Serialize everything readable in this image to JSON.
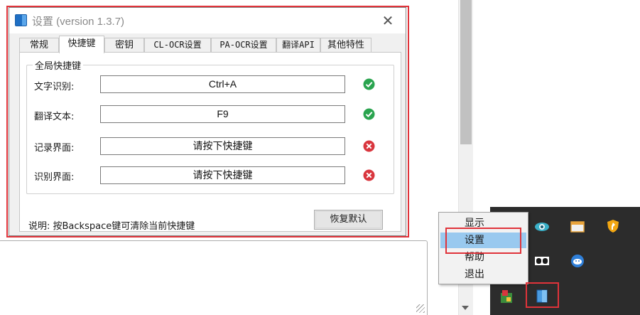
{
  "window": {
    "title": "设置  (version 1.3.7)",
    "close_glyph": "✕"
  },
  "tabs": [
    {
      "label": "常规",
      "active": false
    },
    {
      "label": "快捷键",
      "active": true
    },
    {
      "label": "密钥",
      "active": false
    },
    {
      "label": "CL-OCR设置",
      "active": false
    },
    {
      "label": "PA-OCR设置",
      "active": false
    },
    {
      "label": "翻译API",
      "active": false
    },
    {
      "label": "其他特性",
      "active": false
    }
  ],
  "hotkey_group": {
    "legend": "全局快捷键",
    "rows": [
      {
        "label": "文字识别:",
        "value": "Ctrl+A",
        "status": "ok",
        "status_icon": "check-circle-icon"
      },
      {
        "label": "翻译文本:",
        "value": "F9",
        "status": "ok",
        "status_icon": "check-circle-icon"
      },
      {
        "label": "记录界面:",
        "value": "请按下快捷键",
        "status": "error",
        "status_icon": "x-circle-icon"
      },
      {
        "label": "识别界面:",
        "value": "请按下快捷键",
        "status": "error",
        "status_icon": "x-circle-icon"
      }
    ]
  },
  "hint": "说明: 按Backspace键可清除当前快捷键",
  "restore_default_label": "恢复默认",
  "context_menu": {
    "items": [
      {
        "label": "显示",
        "highlighted": false
      },
      {
        "label": "设置",
        "highlighted": true
      },
      {
        "label": "帮助",
        "highlighted": false
      },
      {
        "label": "退出",
        "highlighted": false
      }
    ]
  },
  "tray": {
    "icons": [
      "eye-icon",
      "window-icon",
      "shield-icon",
      "dolby-icon",
      "fish-icon",
      "game-icon",
      "app-book-icon"
    ]
  },
  "colors": {
    "ok": "#2aa44f",
    "error": "#d9363e",
    "annotation": "#e0333a",
    "menu_highlight": "#99c9ef",
    "tray_bg": "#2c2c2c"
  }
}
